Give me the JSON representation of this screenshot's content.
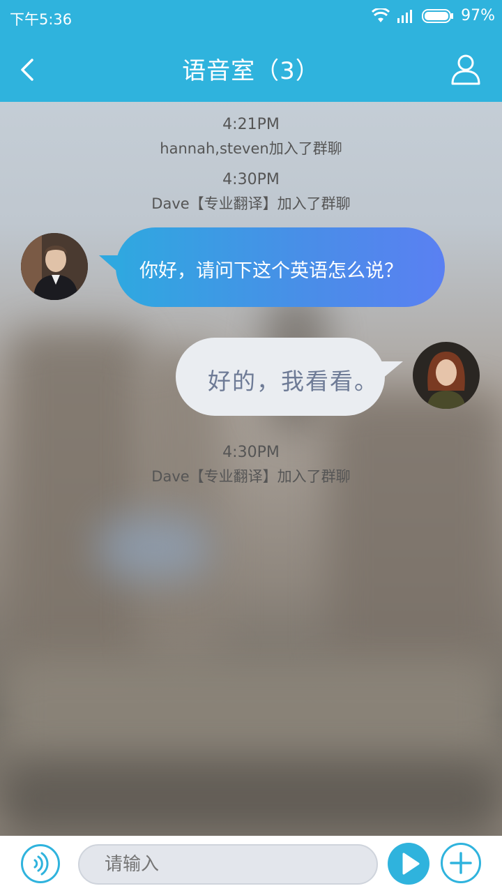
{
  "status_bar": {
    "time": "下午5:36",
    "battery": "97%",
    "icons": [
      "wifi-icon",
      "signal-icon",
      "battery-icon"
    ]
  },
  "nav": {
    "title": "语音室（3）",
    "back_icon": "chevron-left-icon",
    "user_icon": "user-icon"
  },
  "system_messages": [
    {
      "time": "4:21PM",
      "text": "hannah,steven加入了群聊"
    },
    {
      "time": "4:30PM",
      "text": "Dave【专业翻译】加入了群聊"
    },
    {
      "time": "4:30PM",
      "text": "Dave【专业翻译】加入了群聊"
    }
  ],
  "messages": [
    {
      "side": "left",
      "text": "你好，请问下这个英语怎么说？"
    },
    {
      "side": "right",
      "text": "好的，我看看。"
    }
  ],
  "input": {
    "placeholder": "请输入"
  },
  "bottom_icons": [
    "voice-icon",
    "play-icon",
    "plus-icon"
  ],
  "colors": {
    "accent": "#2fb3dd",
    "bubble_gradient_start": "#2fa8e0",
    "bubble_gradient_end": "#5a80f2",
    "bubble_right": "#eaedf1"
  }
}
